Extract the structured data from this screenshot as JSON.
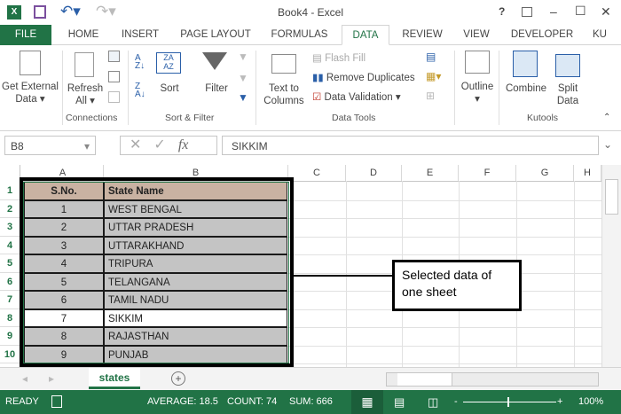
{
  "window": {
    "title": "Book4 - Excel",
    "help": "?",
    "min": "–",
    "max": "☐",
    "close": "✕"
  },
  "tabs": [
    "FILE",
    "HOME",
    "INSERT",
    "PAGE LAYOUT",
    "FORMULAS",
    "DATA",
    "REVIEW",
    "VIEW",
    "DEVELOPER",
    "KU"
  ],
  "active_tab": "DATA",
  "ribbon": {
    "get_external": "Get External",
    "get_external2": "Data ▾",
    "refresh": "Refresh",
    "refresh2": "All ▾",
    "connections": "Connections",
    "sort": "Sort",
    "filter": "Filter",
    "sort_filter": "Sort & Filter",
    "text_to": "Text to",
    "columns": "Columns",
    "flash_fill": "Flash Fill",
    "remove_duplicates": "Remove Duplicates",
    "data_validation": "Data Validation",
    "data_tools": "Data Tools",
    "outline": "Outline",
    "combine": "Combine",
    "split": "Split",
    "split2": "Data",
    "kutools": "Kutools"
  },
  "formula": {
    "name_box": "B8",
    "value": "SIKKIM",
    "fx": "fx"
  },
  "columns": [
    "A",
    "B",
    "C",
    "D",
    "E",
    "F",
    "G",
    "H"
  ],
  "rows": [
    "1",
    "2",
    "3",
    "4",
    "5",
    "6",
    "7",
    "8",
    "9",
    "10"
  ],
  "table": {
    "headers": [
      "S.No.",
      "State Name"
    ],
    "rows": [
      [
        "1",
        "WEST BENGAL"
      ],
      [
        "2",
        "UTTAR PRADESH"
      ],
      [
        "3",
        "UTTARAKHAND"
      ],
      [
        "4",
        "TRIPURA"
      ],
      [
        "5",
        "TELANGANA"
      ],
      [
        "6",
        "TAMIL NADU"
      ],
      [
        "7",
        "SIKKIM"
      ],
      [
        "8",
        "RAJASTHAN"
      ],
      [
        "9",
        "PUNJAB"
      ]
    ]
  },
  "callout": "Selected data of one sheet",
  "sheet_tab": "states",
  "status": {
    "ready": "READY",
    "average": "AVERAGE: 18.5",
    "count": "COUNT: 74",
    "sum": "SUM: 666",
    "zoom": "100%"
  }
}
